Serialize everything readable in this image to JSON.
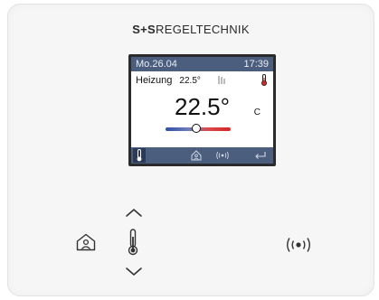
{
  "brand": {
    "part1": "S+S",
    "part2": "REGELTECHNIK"
  },
  "display": {
    "date": "Mo.26.04",
    "time": "17:39",
    "mode_label": "Heizung",
    "setpoint": "22.5°",
    "temperature": "22.5°",
    "unit": "C"
  },
  "icons": {
    "thermometer": "thermometer-icon",
    "home": "home-person-icon",
    "wireless": "wireless-icon",
    "enter": "enter-icon",
    "up": "chevron-up-icon",
    "down": "chevron-down-icon",
    "sun_fan": "sun-heating-icon"
  },
  "colors": {
    "lcd_header": "#4c5e7e",
    "scale_cold": "#2d4fa8",
    "scale_hot": "#d62727"
  }
}
